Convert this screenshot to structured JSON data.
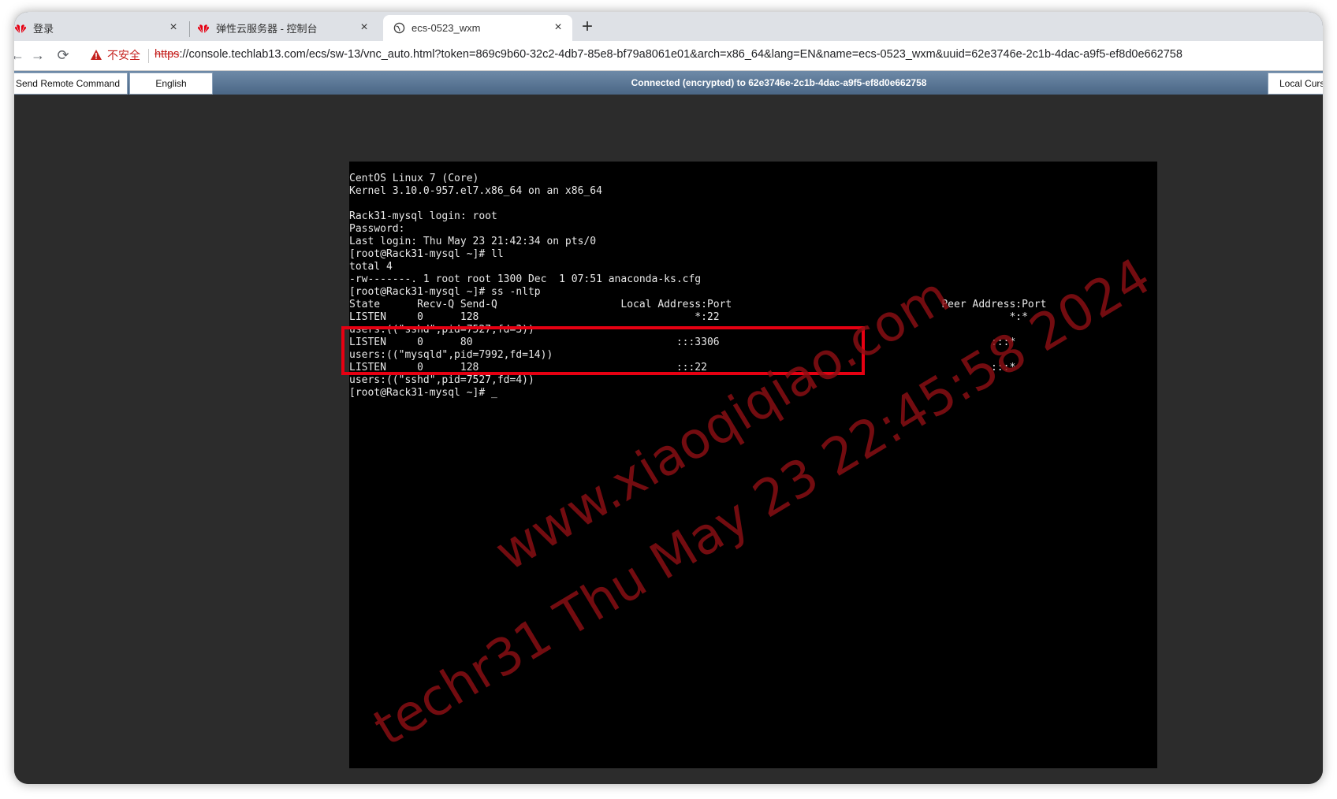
{
  "browser": {
    "tabs": [
      {
        "title": "登录",
        "icon": "huawei-logo-icon",
        "active": false
      },
      {
        "title": "弹性云服务器 - 控制台",
        "icon": "huawei-logo-icon",
        "active": false
      },
      {
        "title": "ecs-0523_wxm",
        "icon": "globe-icon",
        "active": true
      }
    ],
    "close_glyph": "×",
    "new_tab_glyph": "+",
    "security_label": "不安全",
    "url_scheme": "https",
    "url_rest": "://console.techlab13.com/ecs/sw-13/vnc_auto.html?token=869c9b60-32c2-4db7-85e8-bf79a8061e01&arch=x86_64&lang=EN&name=ecs-0523_wxm&uuid=62e3746e-2c1b-4dac-a9f5-ef8d0e662758"
  },
  "vnc": {
    "send_remote_command": "Send Remote Command",
    "language_button": "English",
    "status": "Connected (encrypted) to 62e3746e-2c1b-4dac-a9f5-ef8d0e662758",
    "local_cursor": "Local Cursor"
  },
  "console": {
    "lines": [
      "CentOS Linux 7 (Core)",
      "Kernel 3.10.0-957.el7.x86_64 on an x86_64",
      "",
      "Rack31-mysql login: root",
      "Password:",
      "Last login: Thu May 23 21:42:34 on pts/0",
      "[root@Rack31-mysql ~]# ll",
      "total 4",
      "-rw-------. 1 root root 1300 Dec  1 07:51 anaconda-ks.cfg",
      "[root@Rack31-mysql ~]# ss -nltp",
      "State      Recv-Q Send-Q                    Local Address:Port                                  Peer Address:Port",
      "LISTEN     0      128                                   *:22                                               *:*",
      "users:((\"sshd\",pid=7527,fd=3))",
      "LISTEN     0      80                                 :::3306                                            :::*",
      "users:((\"mysqld\",pid=7992,fd=14))",
      "LISTEN     0      128                                :::22                                              :::*",
      "users:((\"sshd\",pid=7527,fd=4))",
      "[root@Rack31-mysql ~]# _"
    ]
  },
  "watermark": {
    "line1": "www.xiaoqiqiao.com",
    "line2": "techr31 Thu May 23 22:45:58 2024"
  },
  "colors": {
    "highlight": "#e60012",
    "watermark": "#8c0f14",
    "vnc_bar": "#5a7796"
  }
}
